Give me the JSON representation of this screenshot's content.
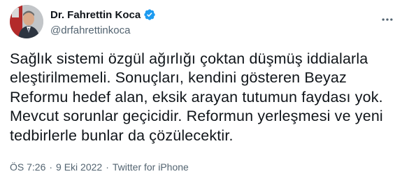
{
  "author": {
    "display_name": "Dr. Fahrettin Koca",
    "handle": "@drfahrettinkoca",
    "verified": true,
    "verified_color": "#1d9bf0"
  },
  "icons": {
    "verified": "verified-badge-icon",
    "more": "more-dots-icon"
  },
  "tweet": {
    "lines": [
      "Sağlık sistemi özgül ağırlığı çoktan düşmüş iddialarla",
      "eleştirilmemeli. Sonuçları, kendini gösteren Beyaz",
      "Reformu hedef alan, eksik arayan tutumun faydası yok.",
      "Mevcut sorunlar geçicidir. Reformun yerleşmesi ve yeni",
      "tedbirlerle bunlar da çözülecektir."
    ]
  },
  "meta": {
    "time": "ÖS 7:26",
    "separator_1": "·",
    "date": "9 Eki 2022",
    "separator_2": "·",
    "source": "Twitter for iPhone"
  },
  "colors": {
    "text": "#0f1419",
    "secondary": "#536471"
  }
}
